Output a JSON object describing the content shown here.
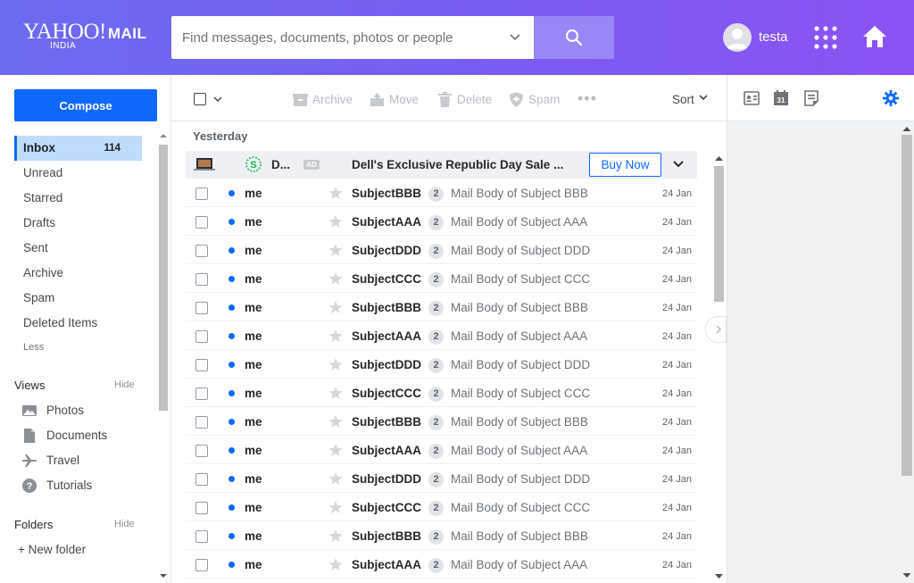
{
  "header": {
    "logo_main": "YAHOO!",
    "logo_mail": "MAIL",
    "logo_sub": "INDIA",
    "search_placeholder": "Find messages, documents, photos or people",
    "username": "testa",
    "accent_color": "#6c6bf0"
  },
  "sidebar": {
    "compose_label": "Compose",
    "items": [
      {
        "label": "Inbox",
        "count": "114",
        "active": true
      },
      {
        "label": "Unread"
      },
      {
        "label": "Starred"
      },
      {
        "label": "Drafts"
      },
      {
        "label": "Sent"
      },
      {
        "label": "Archive"
      },
      {
        "label": "Spam"
      },
      {
        "label": "Deleted Items"
      }
    ],
    "less_label": "Less",
    "views_label": "Views",
    "views_hide": "Hide",
    "views": [
      {
        "label": "Photos",
        "icon": "photo-icon"
      },
      {
        "label": "Documents",
        "icon": "document-icon"
      },
      {
        "label": "Travel",
        "icon": "plane-icon"
      },
      {
        "label": "Tutorials",
        "icon": "help-icon"
      }
    ],
    "folders_label": "Folders",
    "folders_hide": "Hide",
    "new_folder_label": "+ New folder"
  },
  "toolbar": {
    "archive": "Archive",
    "move": "Move",
    "delete": "Delete",
    "spam": "Spam",
    "more": "•••",
    "sort": "Sort"
  },
  "list": {
    "group_label": "Yesterday",
    "ad": {
      "sender": "D...",
      "badge": "AD",
      "subject": "Dell's Exclusive Republic Day Sale ...",
      "cta": "Buy Now"
    },
    "messages": [
      {
        "sender": "me",
        "subject": "SubjectBBB",
        "count": "2",
        "snippet": "Mail Body of Subject BBB",
        "date": "24 Jan"
      },
      {
        "sender": "me",
        "subject": "SubjectAAA",
        "count": "2",
        "snippet": "Mail Body of Subject AAA",
        "date": "24 Jan"
      },
      {
        "sender": "me",
        "subject": "SubjectDDD",
        "count": "2",
        "snippet": "Mail Body of Subject DDD",
        "date": "24 Jan"
      },
      {
        "sender": "me",
        "subject": "SubjectCCC",
        "count": "2",
        "snippet": "Mail Body of Subject CCC",
        "date": "24 Jan"
      },
      {
        "sender": "me",
        "subject": "SubjectBBB",
        "count": "2",
        "snippet": "Mail Body of Subject BBB",
        "date": "24 Jan"
      },
      {
        "sender": "me",
        "subject": "SubjectAAA",
        "count": "2",
        "snippet": "Mail Body of Subject AAA",
        "date": "24 Jan"
      },
      {
        "sender": "me",
        "subject": "SubjectDDD",
        "count": "2",
        "snippet": "Mail Body of Subject DDD",
        "date": "24 Jan"
      },
      {
        "sender": "me",
        "subject": "SubjectCCC",
        "count": "2",
        "snippet": "Mail Body of Subject CCC",
        "date": "24 Jan"
      },
      {
        "sender": "me",
        "subject": "SubjectBBB",
        "count": "2",
        "snippet": "Mail Body of Subject BBB",
        "date": "24 Jan"
      },
      {
        "sender": "me",
        "subject": "SubjectAAA",
        "count": "2",
        "snippet": "Mail Body of Subject AAA",
        "date": "24 Jan"
      },
      {
        "sender": "me",
        "subject": "SubjectDDD",
        "count": "2",
        "snippet": "Mail Body of Subject DDD",
        "date": "24 Jan"
      },
      {
        "sender": "me",
        "subject": "SubjectCCC",
        "count": "2",
        "snippet": "Mail Body of Subject CCC",
        "date": "24 Jan"
      },
      {
        "sender": "me",
        "subject": "SubjectBBB",
        "count": "2",
        "snippet": "Mail Body of Subject BBB",
        "date": "24 Jan"
      },
      {
        "sender": "me",
        "subject": "SubjectAAA",
        "count": "2",
        "snippet": "Mail Body of Subject AAA",
        "date": "24 Jan"
      }
    ]
  },
  "rightrail": {
    "icons": [
      "contacts-icon",
      "calendar-icon",
      "notepad-icon",
      "settings-icon"
    ],
    "calendar_day": "31"
  }
}
